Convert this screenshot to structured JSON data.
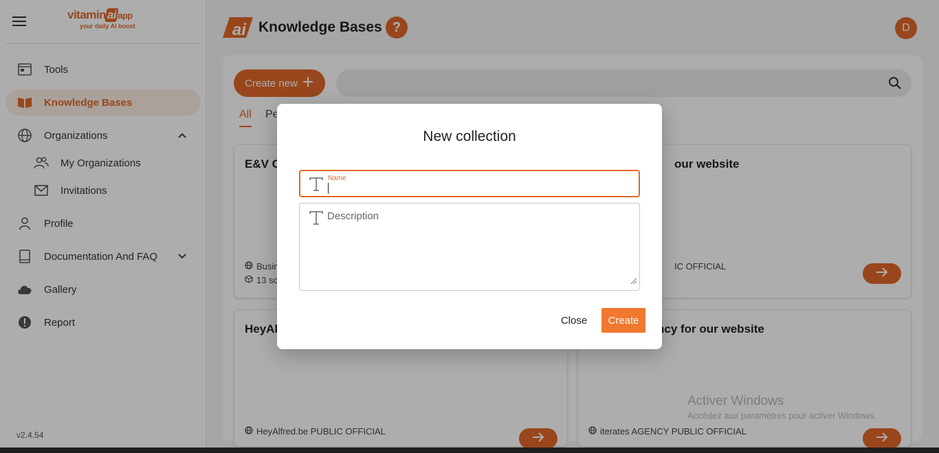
{
  "app": {
    "logo_main": "vitamin",
    "logo_ai": "ai",
    "logo_app": "app",
    "logo_tagline": "your daily AI boost",
    "brand_color": "#e2682a"
  },
  "sidebar": {
    "items": [
      {
        "label": "Tools",
        "icon": "calendar-window-icon"
      },
      {
        "label": "Knowledge Bases",
        "icon": "open-book-icon",
        "active": true
      },
      {
        "label": "Organizations",
        "icon": "globe-icon",
        "expanded": true
      },
      {
        "label": "My Organizations",
        "icon": "people-icon"
      },
      {
        "label": "Invitations",
        "icon": "envelope-icon"
      },
      {
        "label": "Profile",
        "icon": "person-icon"
      },
      {
        "label": "Documentation And FAQ",
        "icon": "book-icon"
      },
      {
        "label": "Gallery",
        "icon": "cloud-icon"
      },
      {
        "label": "Report",
        "icon": "alert-icon"
      }
    ],
    "version": "v2.4.54"
  },
  "header": {
    "title": "Knowledge Bases",
    "help_label": "?",
    "avatar_initial": "D"
  },
  "toolbar": {
    "create_label": "Create new",
    "search_placeholder": ""
  },
  "tabs": {
    "all": "All",
    "pe": "Pe"
  },
  "cards": [
    {
      "title": "E&V C",
      "meta1": "Busin",
      "meta2": "13 so"
    },
    {
      "title": "our website",
      "meta1": "IC OFFICIAL"
    },
    {
      "title": "HeyAl",
      "meta1": "HeyAlfred.be PUBLIC OFFICIAL"
    },
    {
      "title": "ncy for our website",
      "meta1": "iterates AGENCY PUBLIC OFFICIAL"
    }
  ],
  "watermark": {
    "line1": "Activer Windows",
    "line2": "Accédez aux paramètres pour activer Windows."
  },
  "modal": {
    "title": "New collection",
    "name_label": "Name",
    "name_value": "",
    "description_placeholder": "Description",
    "description_value": "",
    "close_label": "Close",
    "create_label": "Create"
  }
}
